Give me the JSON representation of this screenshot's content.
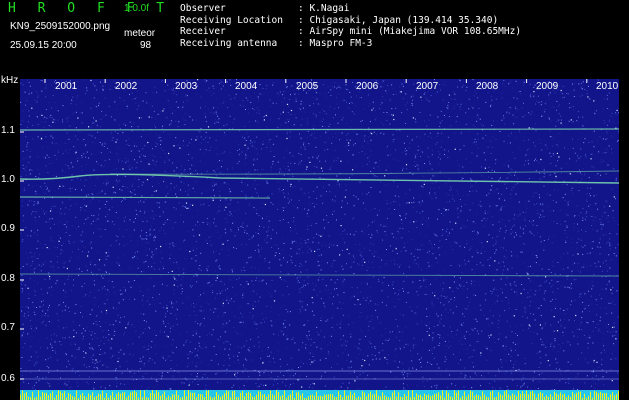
{
  "header": {
    "logo": "H R O F F T",
    "version": "1.0.0f",
    "filename": "KN9_2509152000.png",
    "meteor_label": "meteor",
    "datetime": "25.09.15 20:00",
    "count": "98",
    "observer_label": "Observer",
    "observer": ": K.Nagai",
    "location_label": "Receiving Location",
    "location": ": Chigasaki, Japan (139.414 35.340)",
    "receiver_label": "Receiver",
    "receiver": ": AirSpy mini (Miakejima VOR 108.65MHz)",
    "antenna_label": "Receiving antenna",
    "antenna": ": Maspro FM-3"
  },
  "plot": {
    "unit": "kHz",
    "y_ticks": [
      "1.1",
      "1.0",
      "0.9",
      "0.8",
      "0.7",
      "0.6"
    ],
    "x_labels": [
      "2001",
      "2002",
      "2003",
      "2004",
      "2005",
      "2006",
      "2007",
      "2008",
      "2009",
      "2010"
    ],
    "background_color": "#12158a",
    "trace_color": "#7fe0b0"
  }
}
